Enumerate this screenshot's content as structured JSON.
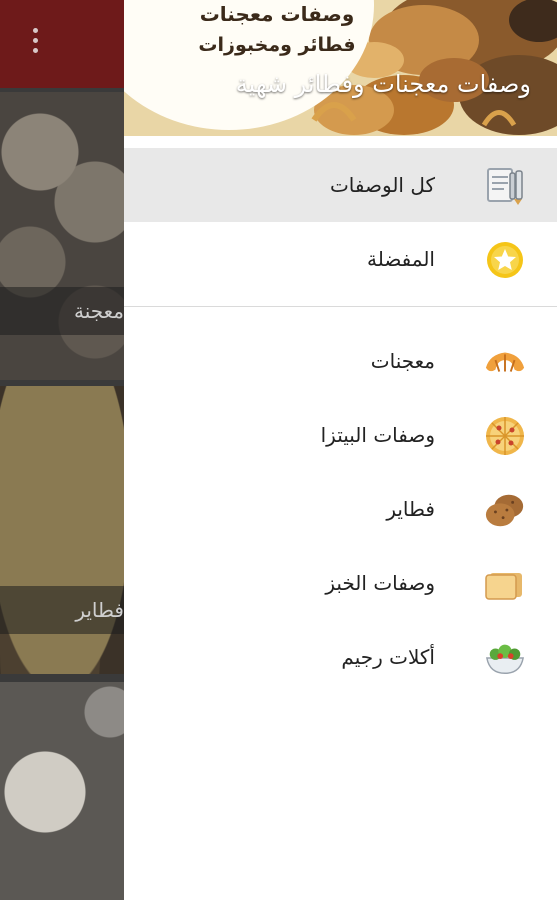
{
  "background_app": {
    "cards": [
      {
        "label": "معجنة"
      },
      {
        "label": "فطاير"
      },
      {
        "label": ""
      }
    ]
  },
  "drawer": {
    "header": {
      "logo_line1": "وصفات معجنات",
      "logo_line2": "فطائر ومخبوزات",
      "title": "وصفات معجنات وفطائر شهية"
    },
    "primary_items": [
      {
        "label": "كل الوصفات",
        "icon": "recipe-book-icon",
        "selected": true
      },
      {
        "label": "المفضلة",
        "icon": "star-icon",
        "selected": false
      }
    ],
    "category_items": [
      {
        "label": "معجنات",
        "icon": "croissant-icon"
      },
      {
        "label": "وصفات البيتزا",
        "icon": "pizza-icon"
      },
      {
        "label": "فطاير",
        "icon": "pastry-icon"
      },
      {
        "label": "وصفات الخبز",
        "icon": "bread-loaf-icon"
      },
      {
        "label": "أكلات رجيم",
        "icon": "salad-icon"
      }
    ]
  },
  "colors": {
    "toolbar": "#6e1a1a",
    "selected_row": "#e8e8e8",
    "star_yellow": "#f5c518"
  }
}
